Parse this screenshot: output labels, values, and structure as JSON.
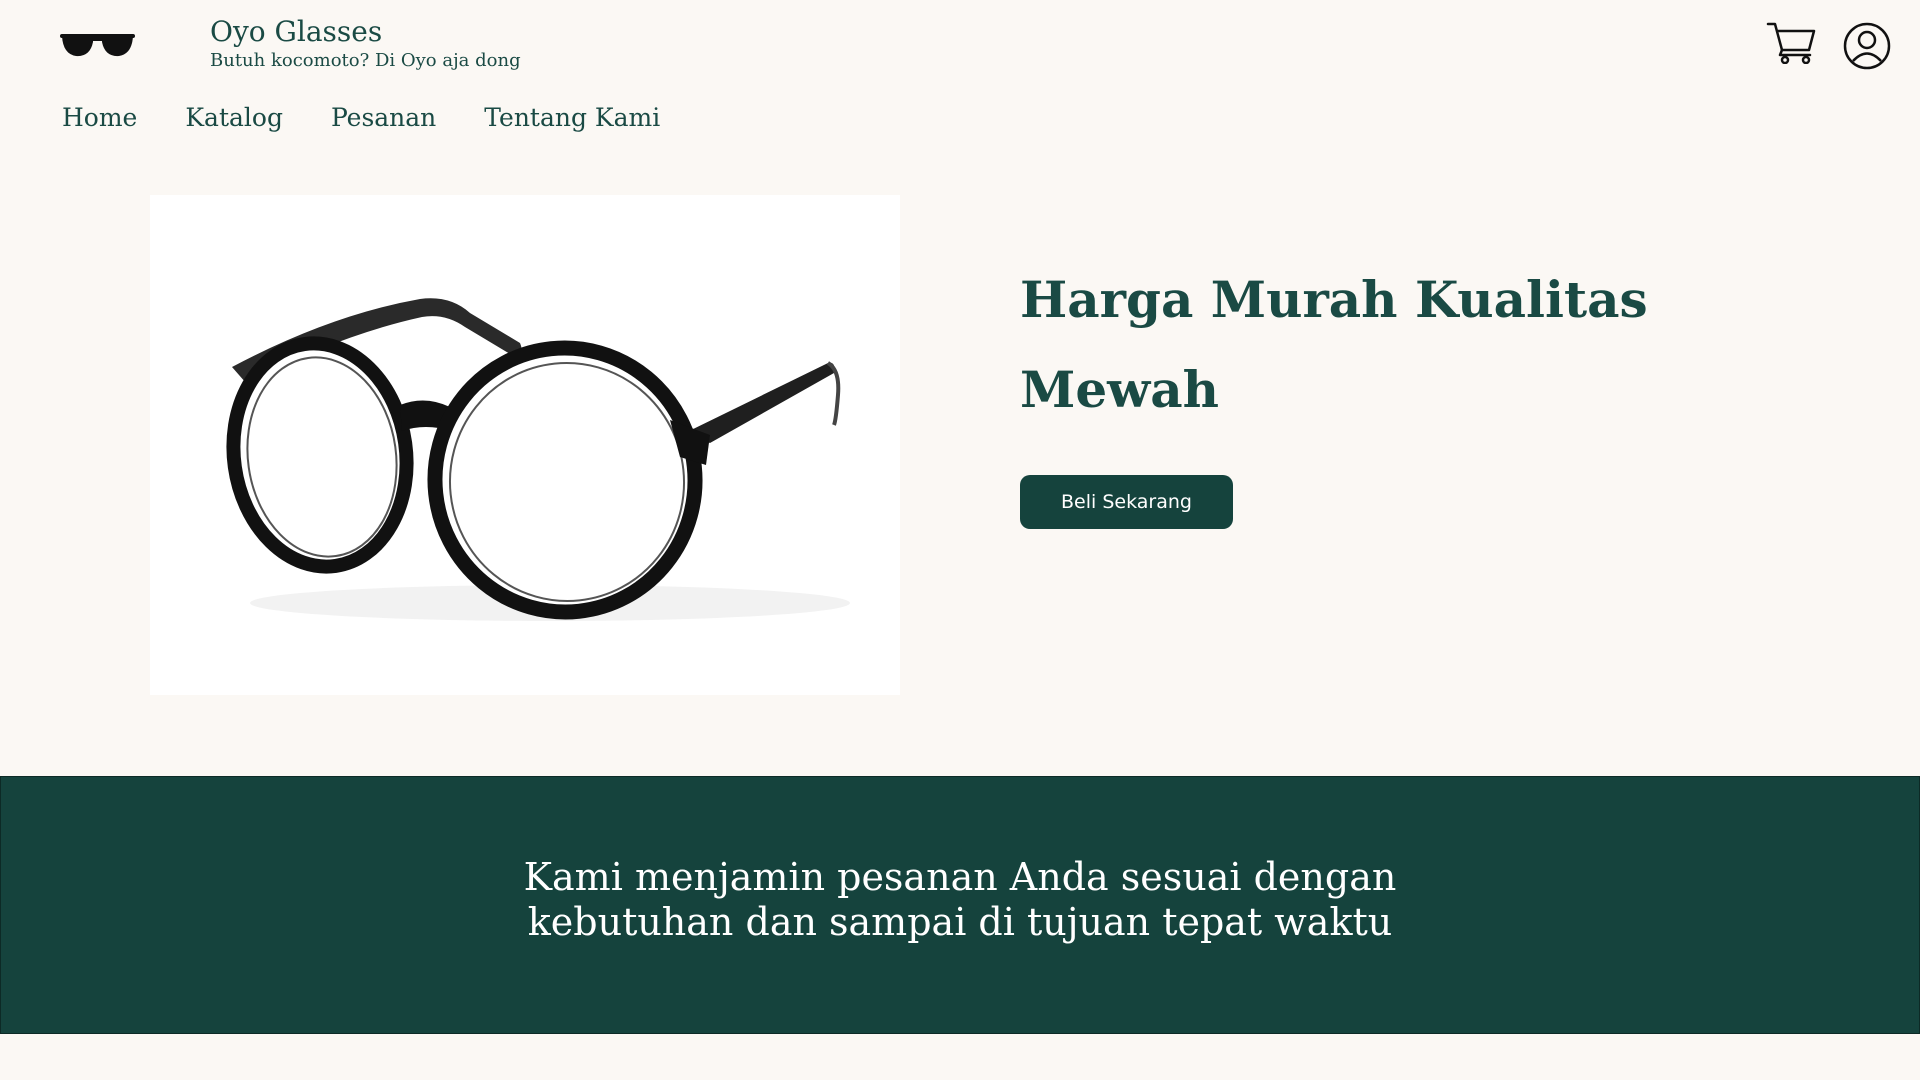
{
  "brand": {
    "title": "Oyo Glasses",
    "tagline": "Butuh kocomoto? Di Oyo aja dong",
    "logo_icon": "sunglasses-icon"
  },
  "nav": {
    "items": [
      {
        "label": "Home"
      },
      {
        "label": "Katalog"
      },
      {
        "label": "Pesanan"
      },
      {
        "label": "Tentang Kami"
      }
    ]
  },
  "header_actions": {
    "cart_icon": "cart-icon",
    "user_icon": "user-icon"
  },
  "hero": {
    "heading": "Harga Murah Kualitas Mewah",
    "button_label": "Beli Sekarang",
    "image": "eyeglasses-product-image"
  },
  "banner": {
    "text": "Kami menjamin pesanan Anda sesuai dengan kebutuhan dan sampai di tujuan tepat waktu"
  },
  "colors": {
    "background": "#fbf8f4",
    "primary": "#15433d",
    "text": "#1a4a44",
    "white": "#ffffff"
  }
}
